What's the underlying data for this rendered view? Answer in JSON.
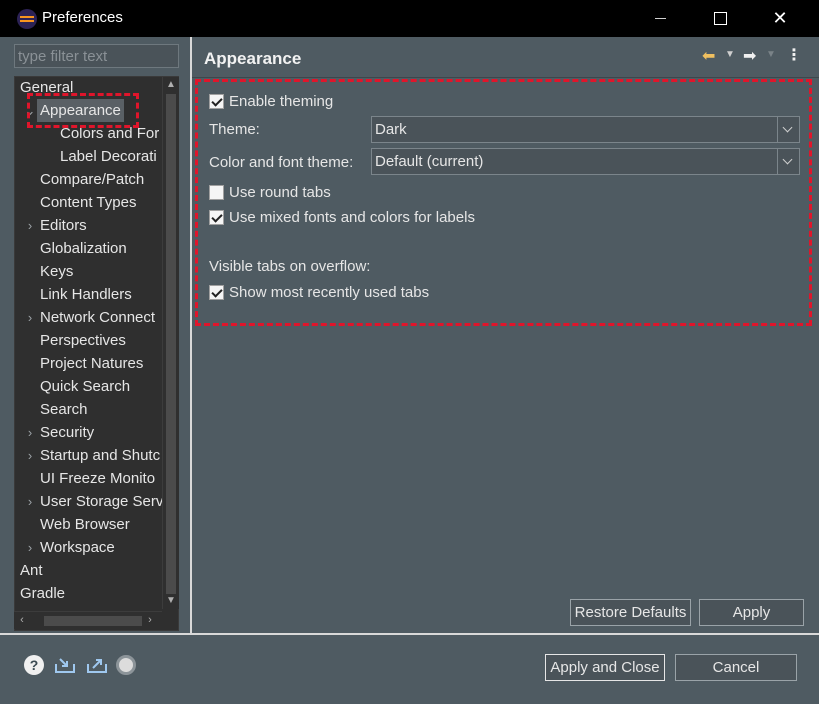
{
  "window": {
    "title": "Preferences",
    "controls": [
      "minimize",
      "maximize",
      "close"
    ]
  },
  "sidebar": {
    "filter_placeholder": "type filter text",
    "tree": [
      {
        "label": "General",
        "level": 0,
        "expandable": false,
        "selected": false
      },
      {
        "label": "Appearance",
        "level": 1,
        "expandable": true,
        "expanded": true,
        "selected": true
      },
      {
        "label": "Colors and For",
        "level": 2,
        "expandable": false,
        "selected": false
      },
      {
        "label": "Label Decorati",
        "level": 2,
        "expandable": false,
        "selected": false
      },
      {
        "label": "Compare/Patch",
        "level": 1,
        "expandable": false,
        "selected": false
      },
      {
        "label": "Content Types",
        "level": 1,
        "expandable": false,
        "selected": false
      },
      {
        "label": "Editors",
        "level": 1,
        "expandable": true,
        "expanded": false,
        "selected": false
      },
      {
        "label": "Globalization",
        "level": 1,
        "expandable": false,
        "selected": false
      },
      {
        "label": "Keys",
        "level": 1,
        "expandable": false,
        "selected": false
      },
      {
        "label": "Link Handlers",
        "level": 1,
        "expandable": false,
        "selected": false
      },
      {
        "label": "Network Connect",
        "level": 1,
        "expandable": true,
        "expanded": false,
        "selected": false
      },
      {
        "label": "Perspectives",
        "level": 1,
        "expandable": false,
        "selected": false
      },
      {
        "label": "Project Natures",
        "level": 1,
        "expandable": false,
        "selected": false
      },
      {
        "label": "Quick Search",
        "level": 1,
        "expandable": false,
        "selected": false
      },
      {
        "label": "Search",
        "level": 1,
        "expandable": false,
        "selected": false
      },
      {
        "label": "Security",
        "level": 1,
        "expandable": true,
        "expanded": false,
        "selected": false
      },
      {
        "label": "Startup and Shutc",
        "level": 1,
        "expandable": true,
        "expanded": false,
        "selected": false
      },
      {
        "label": "UI Freeze Monito",
        "level": 1,
        "expandable": false,
        "selected": false
      },
      {
        "label": "User Storage Serv",
        "level": 1,
        "expandable": true,
        "expanded": false,
        "selected": false
      },
      {
        "label": "Web Browser",
        "level": 1,
        "expandable": false,
        "selected": false
      },
      {
        "label": "Workspace",
        "level": 1,
        "expandable": true,
        "expanded": false,
        "selected": false
      },
      {
        "label": "Ant",
        "level": 0,
        "expandable": false,
        "selected": false
      },
      {
        "label": "Gradle",
        "level": 0,
        "expandable": false,
        "selected": false
      }
    ]
  },
  "page": {
    "title": "Appearance",
    "enable_theming": {
      "label": "Enable theming",
      "checked": true
    },
    "theme": {
      "label": "Theme:",
      "value": "Dark"
    },
    "color_font_theme": {
      "label": "Color and font theme:",
      "value": "Default (current)"
    },
    "round_tabs": {
      "label": "Use round tabs",
      "checked": false
    },
    "mixed_fonts": {
      "label": "Use mixed fonts and colors for labels",
      "checked": true
    },
    "overflow_heading": "Visible tabs on overflow:",
    "recent_tabs": {
      "label": "Show most recently used tabs",
      "checked": true
    },
    "restore_defaults": "Restore Defaults",
    "apply": "Apply"
  },
  "footer": {
    "apply_and_close": "Apply and Close",
    "cancel": "Cancel",
    "icons": [
      "help-icon",
      "import-icon",
      "export-icon",
      "oomph-icon"
    ]
  },
  "colors": {
    "background": "#4f5b62",
    "tree_background": "#2f2f2f",
    "highlight": "#e0152b",
    "title_bar": "#000000"
  }
}
